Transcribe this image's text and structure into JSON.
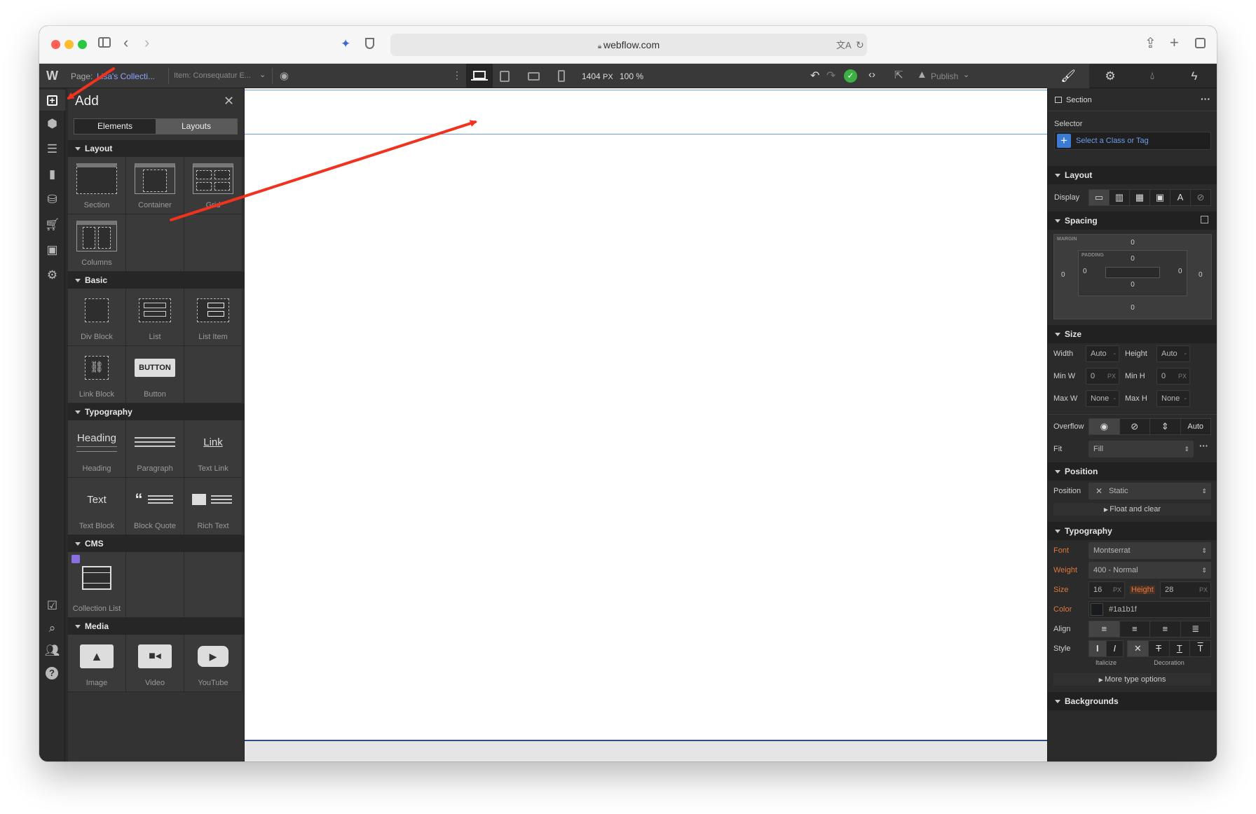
{
  "browser": {
    "url": "webflow.com"
  },
  "topbar": {
    "page_label": "Page:",
    "page_name": "Lisa's Collecti...",
    "item_label": "Item: Consequatur E...",
    "width_value": "1404",
    "width_unit": "PX",
    "zoom": "100",
    "zoom_unit": "%",
    "publish": "Publish"
  },
  "add_panel": {
    "title": "Add",
    "tabs": [
      "Elements",
      "Layouts"
    ],
    "categories": [
      {
        "name": "Layout",
        "items": [
          "Section",
          "Container",
          "Grid",
          "Columns"
        ]
      },
      {
        "name": "Basic",
        "items": [
          "Div Block",
          "List",
          "List Item",
          "Link Block",
          "Button"
        ]
      },
      {
        "name": "Typography",
        "items": [
          "Heading",
          "Paragraph",
          "Text Link",
          "Text Block",
          "Block Quote",
          "Rich Text"
        ]
      },
      {
        "name": "CMS",
        "items": [
          "Collection List"
        ]
      },
      {
        "name": "Media",
        "items": [
          "Image",
          "Video",
          "YouTube"
        ]
      }
    ],
    "previews": {
      "button": "BUTTON",
      "heading": "Heading",
      "link": "Link",
      "text": "Text"
    }
  },
  "style_panel": {
    "element": "Section",
    "selector_label": "Selector",
    "selector_placeholder": "Select a Class or Tag",
    "layout": {
      "title": "Layout",
      "display_label": "Display"
    },
    "spacing": {
      "title": "Spacing",
      "margin_label": "MARGIN",
      "padding_label": "PADDING",
      "margin": {
        "top": "0",
        "right": "0",
        "bottom": "0",
        "left": "0"
      },
      "padding": {
        "top": "0",
        "right": "0",
        "bottom": "0",
        "left": "0"
      }
    },
    "size": {
      "title": "Size",
      "width_label": "Width",
      "width": "Auto",
      "height_label": "Height",
      "height": "Auto",
      "minw_label": "Min W",
      "minw": "0",
      "minh_label": "Min H",
      "minh": "0",
      "maxw_label": "Max W",
      "maxw": "None",
      "maxh_label": "Max H",
      "maxh": "None",
      "unit": "PX",
      "dash": "-"
    },
    "overflow_label": "Overflow",
    "overflow_auto": "Auto",
    "fit_label": "Fit",
    "fit": "Fill",
    "position": {
      "title": "Position",
      "label": "Position",
      "value": "Static",
      "float": "Float and clear"
    },
    "typography": {
      "title": "Typography",
      "font_label": "Font",
      "font": "Montserrat",
      "weight_label": "Weight",
      "weight": "400 - Normal",
      "size_label": "Size",
      "size": "16",
      "height_label": "Height",
      "height": "28",
      "unit": "PX",
      "color_label": "Color",
      "color": "#1a1b1f",
      "align_label": "Align",
      "style_label": "Style",
      "italicize": "Italicize",
      "decoration": "Decoration",
      "more": "More type options"
    },
    "backgrounds": {
      "title": "Backgrounds"
    }
  },
  "colors": {
    "accent": "#4a90e2",
    "annotation": "#f0321f",
    "success": "#3cb043",
    "label_orange": "#e0763c"
  }
}
